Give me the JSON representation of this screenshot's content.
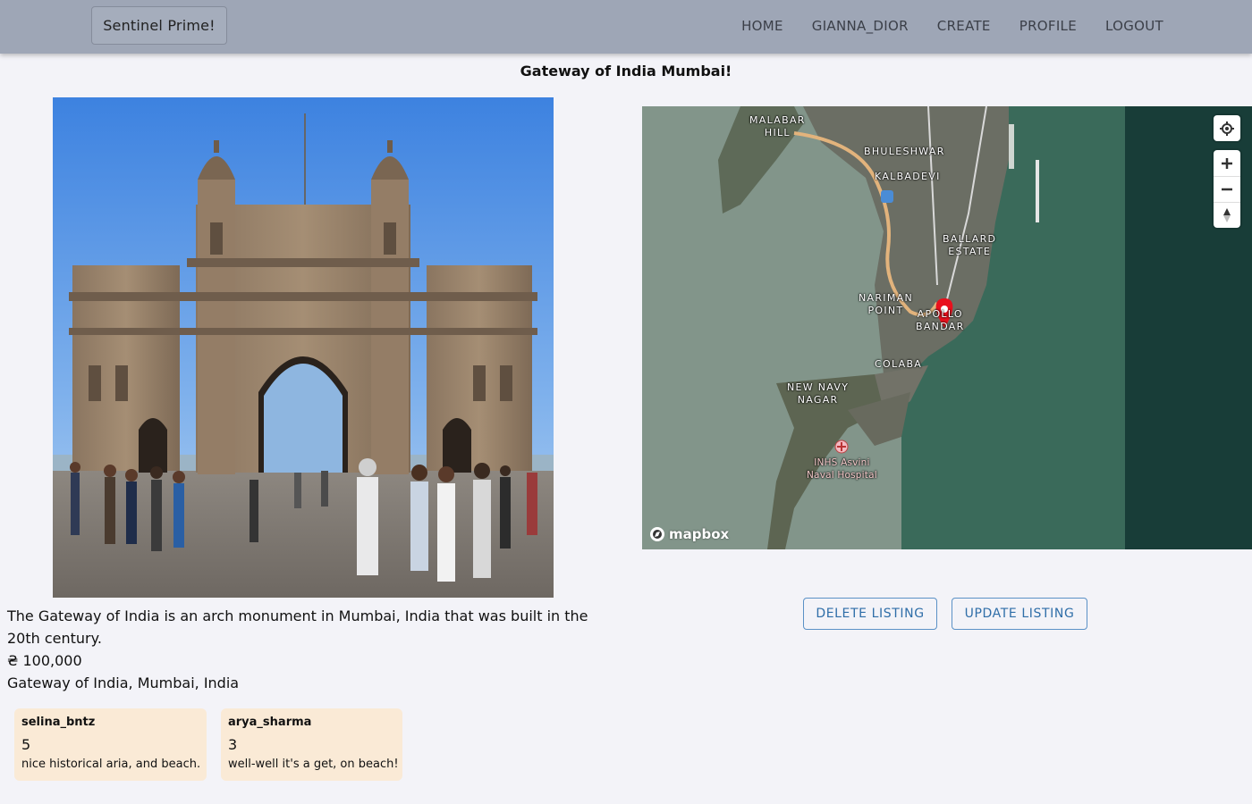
{
  "header": {
    "brand": "Sentinel Prime!",
    "nav": [
      "HOME",
      "GIANNA_DIOR",
      "CREATE",
      "PROFILE",
      "LOGOUT"
    ]
  },
  "listing": {
    "title": "Gateway of India Mumbai!",
    "description": "The Gateway of India is an arch monument in Mumbai, India that was built in the 20th century.",
    "price": "₴ 100,000",
    "location": "Gateway of India, Mumbai, India",
    "image_subject": "Gateway of India arch monument with crowd"
  },
  "map": {
    "labels": {
      "malabar": "MALABAR\nHILL",
      "bhuleshwar": "BHULESHWAR",
      "kalbadevi": "KALBADEVI",
      "ballard": "BALLARD\nESTATE",
      "nariman": "NARIMAN\nPOINT",
      "apollo": "APOLLO\nBANDAR",
      "colaba": "COLABA",
      "newnavy": "NEW NAVY\nNAGAR",
      "hospital": "INHS Asvini\nNaval Hospital"
    },
    "attribution": "mapbox",
    "controls": [
      "geolocate-icon",
      "zoom-in-icon",
      "zoom-out-icon",
      "compass-icon"
    ],
    "marker_color": "#e8101d"
  },
  "actions": {
    "delete": "DELETE LISTING",
    "update": "UPDATE LISTING"
  },
  "reviews": [
    {
      "user": "selina_bntz",
      "rating": "5",
      "text": "nice historical aria, and beach."
    },
    {
      "user": "arya_sharma",
      "rating": "3",
      "text": "well-well it's a get, on beach!"
    }
  ],
  "colors": {
    "header_bg": "#9ea6b6",
    "page_bg": "#f3f3f8",
    "review_bg": "#faead6",
    "button_outline": "#5b91c6"
  }
}
